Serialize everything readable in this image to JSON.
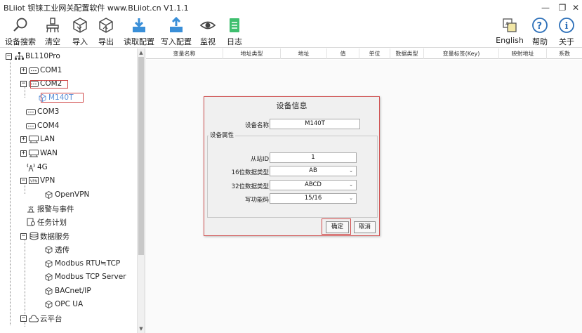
{
  "window": {
    "title": "BLiiot 钡铼工业网关配置软件 www.BLiiot.cn V1.1.1",
    "controls": [
      "—",
      "❐",
      "✕"
    ]
  },
  "toolbar": {
    "left_buttons": [
      {
        "label": "设备搜索",
        "icon": "search-icon"
      },
      {
        "label": "清空",
        "icon": "clear-icon"
      },
      {
        "label": "导入",
        "icon": "import-icon"
      },
      {
        "label": "导出",
        "icon": "export-icon"
      },
      {
        "label": "读取配置",
        "icon": "read-config-icon"
      },
      {
        "label": "写入配置",
        "icon": "write-config-icon"
      },
      {
        "label": "监视",
        "icon": "eye-icon"
      },
      {
        "label": "日志",
        "icon": "log-icon"
      }
    ],
    "right_buttons": [
      {
        "label": "English",
        "icon": "language-icon"
      },
      {
        "label": "帮助",
        "icon": "help-icon"
      },
      {
        "label": "关于",
        "icon": "info-icon"
      }
    ]
  },
  "tree": {
    "root": "BL110Pro",
    "items": [
      {
        "label": "COM1",
        "icon": "serial-port-icon",
        "expander": "+"
      },
      {
        "label": "COM2",
        "icon": "serial-port-icon",
        "expander": "−"
      },
      {
        "label": "M140T",
        "icon": "device-icon"
      },
      {
        "label": "COM3",
        "icon": "serial-port-icon"
      },
      {
        "label": "COM4",
        "icon": "serial-port-icon"
      },
      {
        "label": "LAN",
        "icon": "network-icon",
        "expander": "+"
      },
      {
        "label": "WAN",
        "icon": "network-icon",
        "expander": "+"
      },
      {
        "label": "4G",
        "icon": "antenna-icon"
      },
      {
        "label": "VPN",
        "icon": "vpn-icon",
        "expander": "−"
      },
      {
        "label": "OpenVPN",
        "icon": "cube-icon"
      },
      {
        "label": "报警与事件",
        "icon": "alarm-icon"
      },
      {
        "label": "任务计划",
        "icon": "task-icon"
      },
      {
        "label": "数据服务",
        "icon": "database-icon",
        "expander": "−"
      },
      {
        "label": "透传",
        "icon": "cube-icon"
      },
      {
        "label": "Modbus RTU≒TCP",
        "icon": "cube-icon"
      },
      {
        "label": "Modbus TCP Server",
        "icon": "cube-icon"
      },
      {
        "label": "BACnet/IP",
        "icon": "cube-icon"
      },
      {
        "label": "OPC UA",
        "icon": "cube-icon"
      },
      {
        "label": "云平台",
        "icon": "cloud-icon",
        "expander": "−"
      }
    ]
  },
  "grid": {
    "columns": [
      "变量名称",
      "地址类型",
      "地址",
      "值",
      "单位",
      "数据类型",
      "变量标签(Key)",
      "映射地址",
      "系数"
    ]
  },
  "dialog": {
    "title": "设备信息",
    "device_name_label": "设备名称",
    "device_name_value": "M140T",
    "group_title": "设备属性",
    "fields": [
      {
        "label": "从站ID",
        "value": "1",
        "kind": "input"
      },
      {
        "label": "16位数据类型",
        "value": "AB",
        "kind": "select"
      },
      {
        "label": "32位数据类型",
        "value": "ABCD",
        "kind": "select"
      },
      {
        "label": "写功能码",
        "value": "15/16",
        "kind": "select"
      }
    ],
    "ok_label": "确定",
    "cancel_label": "取消"
  },
  "colors": {
    "highlight": "#d04848",
    "selected_text": "#5b8fd6"
  }
}
